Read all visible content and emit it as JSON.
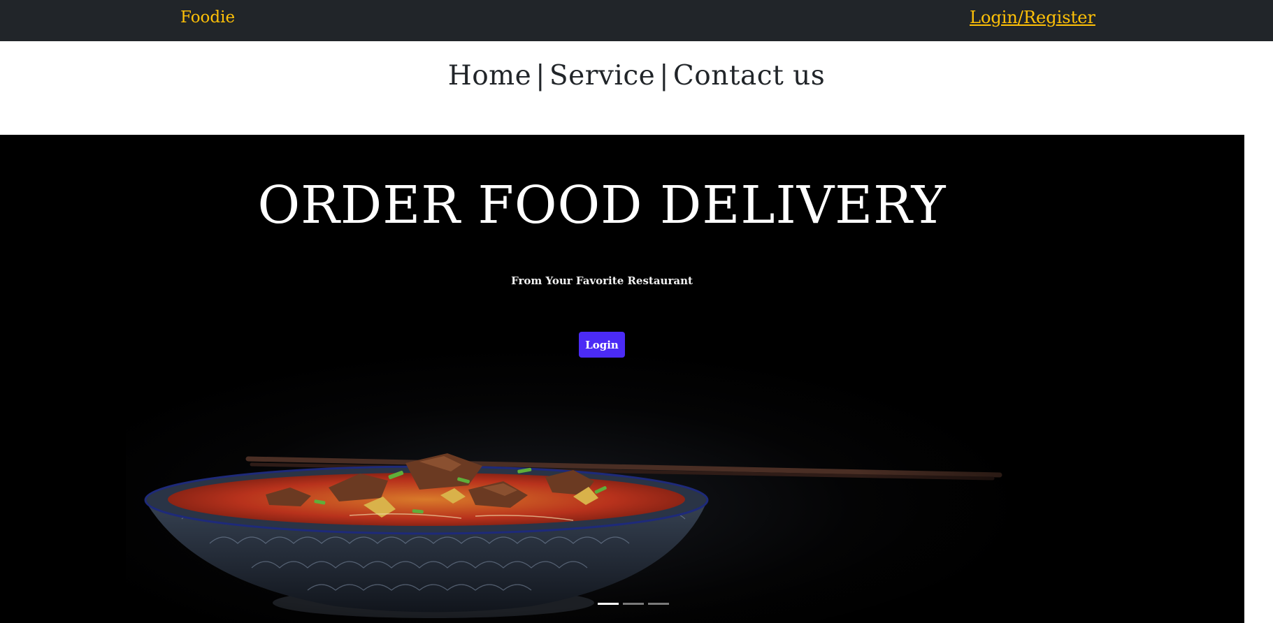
{
  "header": {
    "brand": "Foodie",
    "login_register": "Login/Register"
  },
  "nav": {
    "items": [
      {
        "label": "Home"
      },
      {
        "label": "Service"
      },
      {
        "label": "Contact us"
      }
    ],
    "separator": "|"
  },
  "hero": {
    "title": "ORDER FOOD DELIVERY",
    "subtitle": "From Your Favorite Restaurant",
    "button_label": "Login",
    "carousel": {
      "slides_count": 3,
      "active_index": 0
    }
  },
  "colors": {
    "topbar": "#212529",
    "accent": "#ffc107",
    "button": "#4b2bf5",
    "hero_bg": "#000000"
  }
}
